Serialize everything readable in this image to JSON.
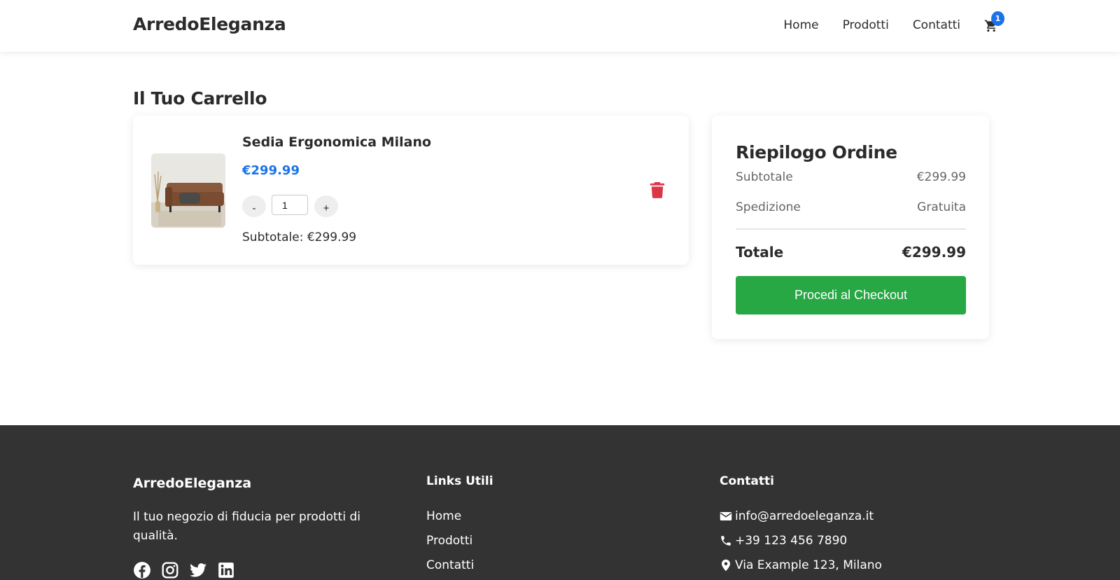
{
  "header": {
    "brand": "ArredoEleganza",
    "nav": [
      "Home",
      "Prodotti",
      "Contatti"
    ],
    "cart_count": "1"
  },
  "cart": {
    "title": "Il Tuo Carrello",
    "item": {
      "name": "Sedia Ergonomica Milano",
      "price": "€299.99",
      "decrement": "-",
      "increment": "+",
      "quantity": "1",
      "subtotal": "Subtotale: €299.99"
    }
  },
  "summary": {
    "title": "Riepilogo Ordine",
    "subtotal_label": "Subtotale",
    "subtotal_value": "€299.99",
    "shipping_label": "Spedizione",
    "shipping_value": "Gratuita",
    "total_label": "Totale",
    "total_value": "€299.99",
    "checkout": "Procedi al Checkout"
  },
  "footer": {
    "brand": "ArredoEleganza",
    "tagline": "Il tuo negozio di fiducia per prodotti di qualità.",
    "links_title": "Links Utili",
    "links": [
      "Home",
      "Prodotti",
      "Contatti"
    ],
    "contacts_title": "Contatti",
    "email": "info@arredoeleganza.it",
    "phone": "+39 123 456 7890",
    "address": "Via Example 123, Milano"
  },
  "colors": {
    "accent": "#1a73e8",
    "checkout": "#28a745",
    "delete": "#dc3545",
    "footer_bg": "#333333"
  },
  "icons": [
    "cart-icon",
    "trash-icon",
    "facebook-icon",
    "instagram-icon",
    "twitter-icon",
    "linkedin-icon",
    "envelope-icon",
    "phone-icon",
    "map-marker-icon"
  ]
}
